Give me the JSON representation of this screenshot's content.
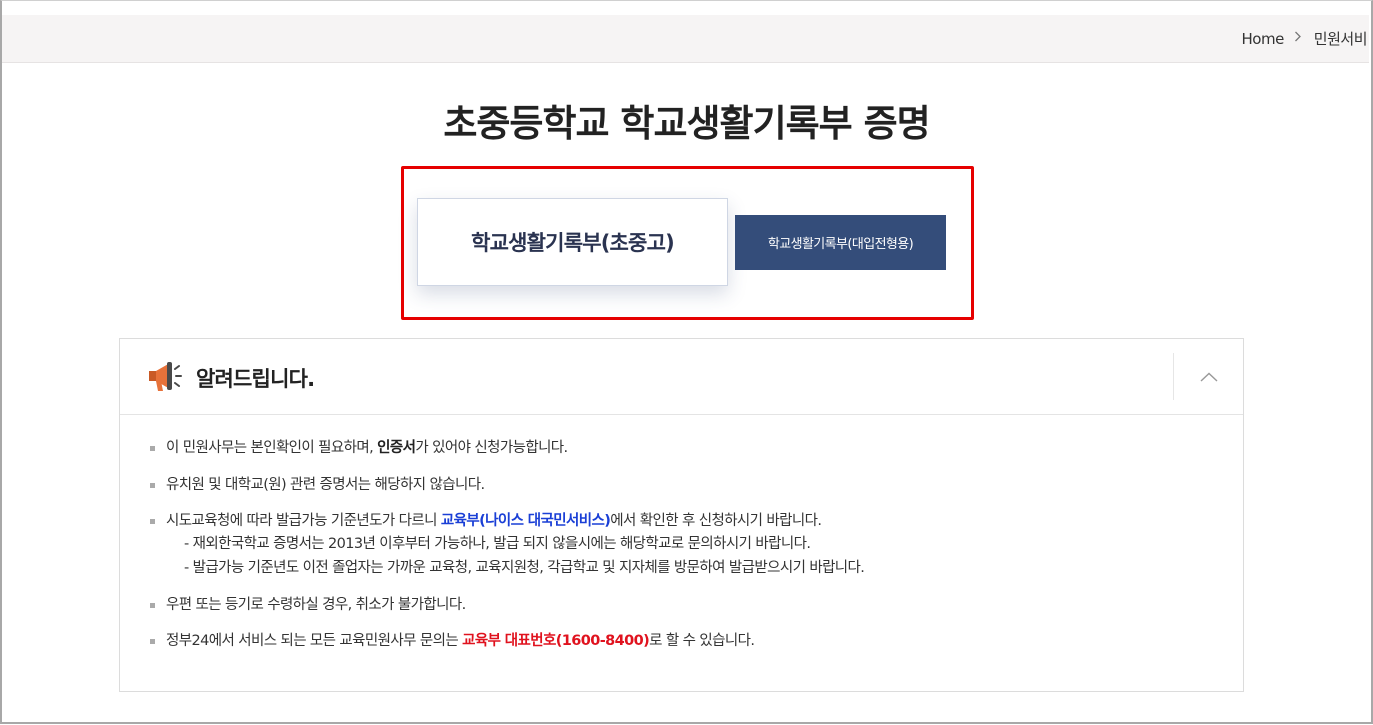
{
  "breadcrumb": {
    "home": "Home",
    "current": "민원서비"
  },
  "page": {
    "title": "초중등학교 학교생활기록부 증명"
  },
  "tabs": [
    {
      "label": "학교생활기록부(초중고)",
      "active": true
    },
    {
      "label": "학교생활기록부(대입전형용)",
      "active": false
    }
  ],
  "notice": {
    "title": "알려드립니다.",
    "items": [
      {
        "pre": "이 민원사무는 본인확인이 필요하며, ",
        "emph": "인증서",
        "post": "가 있어야 신청가능합니다."
      },
      {
        "text": "유치원 및 대학교(원) 관련 증명서는 해당하지 않습니다."
      },
      {
        "pre": "시도교육청에 따라 발급가능 기준년도가 다르니 ",
        "link": "교육부(나이스 대국민서비스)",
        "post": "에서 확인한 후 신청하시기 바랍니다.",
        "subs": [
          "- 재외한국학교 증명서는 2013년 이후부터 가능하나, 발급 되지 않을시에는 해당학교로 문의하시기 바랍니다.",
          "- 발급가능 기준년도 이전 졸업자는 가까운 교육청, 교육지원청, 각급학교 및 지자체를 방문하여 발급받으시기 바랍니다."
        ]
      },
      {
        "text": "우편 또는 등기로 수령하실 경우, 취소가 불가합니다."
      },
      {
        "pre": "정부24에서 서비스 되는 모든 교육민원사무 문의는 ",
        "red": "교육부 대표번호(1600-8400)",
        "post": "로 할 수 있습니다."
      }
    ]
  },
  "colors": {
    "highlight": "#e60000",
    "tab_inactive_bg": "#344d7a",
    "link_blue": "#1a3fd6",
    "emphasis_red": "#e0121e",
    "megaphone": "#e7723a"
  },
  "icons": {
    "breadcrumb_separator": "chevron-right-icon",
    "notice": "megaphone-icon",
    "collapse": "chevron-up-icon"
  }
}
